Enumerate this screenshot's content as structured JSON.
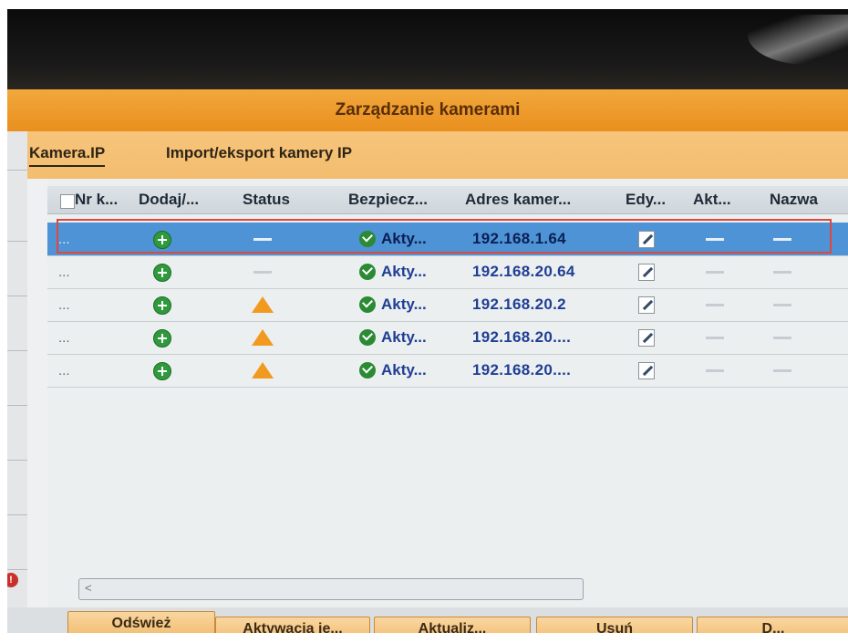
{
  "window": {
    "title": "Zarządzanie kamerami"
  },
  "tabs": [
    {
      "label": "Kamera.IP",
      "active": true
    },
    {
      "label": "Import/eksport kamery IP",
      "active": false
    }
  ],
  "table": {
    "headers": [
      "Nr k...",
      "Dodaj/...",
      "Status",
      "Bezpiecz...",
      "Adres kamer...",
      "Edy...",
      "Akt...",
      "Nazwa"
    ],
    "rows": [
      {
        "nr": "...",
        "status_icon": "dash",
        "security": "Akty...",
        "ip": "192.168.1.64",
        "selected": true
      },
      {
        "nr": "...",
        "status_icon": "dash",
        "security": "Akty...",
        "ip": "192.168.20.64",
        "selected": false
      },
      {
        "nr": "...",
        "status_icon": "warning-icon",
        "security": "Akty...",
        "ip": "192.168.20.2",
        "selected": false
      },
      {
        "nr": "...",
        "status_icon": "warning-icon",
        "security": "Akty...",
        "ip": "192.168.20....",
        "selected": false
      },
      {
        "nr": "...",
        "status_icon": "warning-icon",
        "security": "Akty...",
        "ip": "192.168.20....",
        "selected": false
      }
    ]
  },
  "scrollbar": {
    "left_arrow": "<"
  },
  "buttons": {
    "refresh": "Odśwież",
    "activate": "Aktywacja je...",
    "update": "Aktualiz...",
    "delete": "Usuń",
    "next": "D..."
  },
  "colors": {
    "title_bar": "#e98f1e",
    "tab_bar": "#f3bd6f",
    "selected_row": "#4d93d6",
    "ip_text": "#1f3e94",
    "highlight_frame": "#e0473f"
  },
  "notification_badge": "!"
}
